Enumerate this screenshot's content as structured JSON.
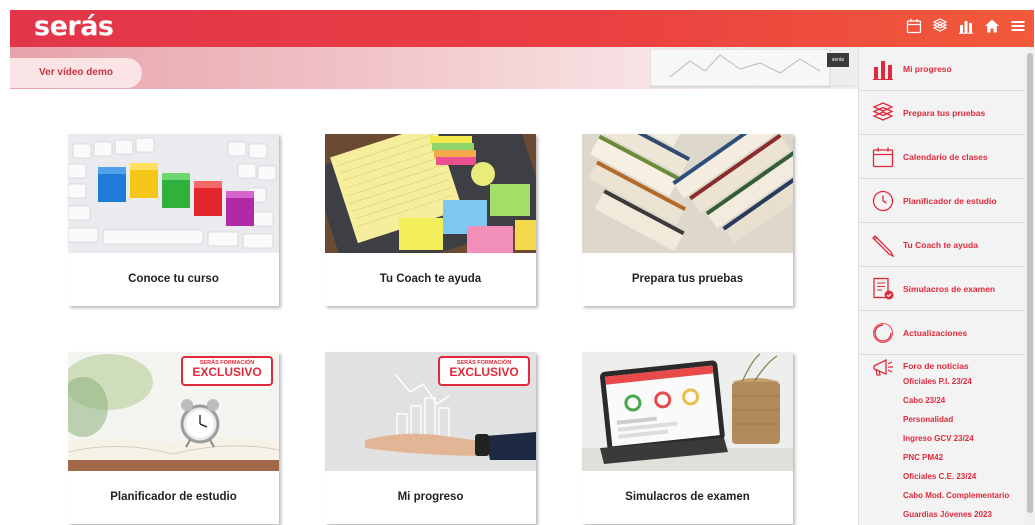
{
  "header": {
    "logo": "serás",
    "icons": [
      "calendar-icon",
      "books-icon",
      "bar-chart-icon",
      "home-icon",
      "menu-icon"
    ]
  },
  "banner": {
    "demo_button": "Ver vídeo demo",
    "laptop_badge": "serás"
  },
  "exclusive_badge": {
    "line1": "SERÁS FORMACIÓN",
    "line2": "EXCLUSIVO"
  },
  "cards": [
    {
      "title": "Conoce tu curso"
    },
    {
      "title": "Tu Coach te ayuda"
    },
    {
      "title": "Prepara tus pruebas"
    },
    {
      "title": "Planificador de estudio"
    },
    {
      "title": "Mi progreso"
    },
    {
      "title": "Simulacros de examen"
    }
  ],
  "sidebar": {
    "items": [
      {
        "label": "Mi progreso",
        "icon": "bar-chart-icon"
      },
      {
        "label": "Prepara tus pruebas",
        "icon": "books-icon"
      },
      {
        "label": "Calendario de clases",
        "icon": "calendar-icon"
      },
      {
        "label": "Planificador de estudio",
        "icon": "clock-icon"
      },
      {
        "label": "Tu Coach te ayuda",
        "icon": "pencil-icon"
      },
      {
        "label": "Simulacros de examen",
        "icon": "exam-icon"
      },
      {
        "label": "Actualizaciones",
        "icon": "refresh-icon"
      }
    ],
    "news": {
      "label": "Foro de noticias",
      "icon": "megaphone-icon",
      "links": [
        "Oficiales P.I. 23/24",
        "Cabo 23/24",
        "Personalidad",
        "Ingreso GCV 23/24",
        "PNC PM42",
        "Oficiales C.E. 23/24",
        "Cabo Mod. Complementario",
        "Guardias Jóvenes 2023"
      ]
    }
  },
  "colors": {
    "brand": "#e2354a",
    "accent_text": "#e02a3c"
  }
}
